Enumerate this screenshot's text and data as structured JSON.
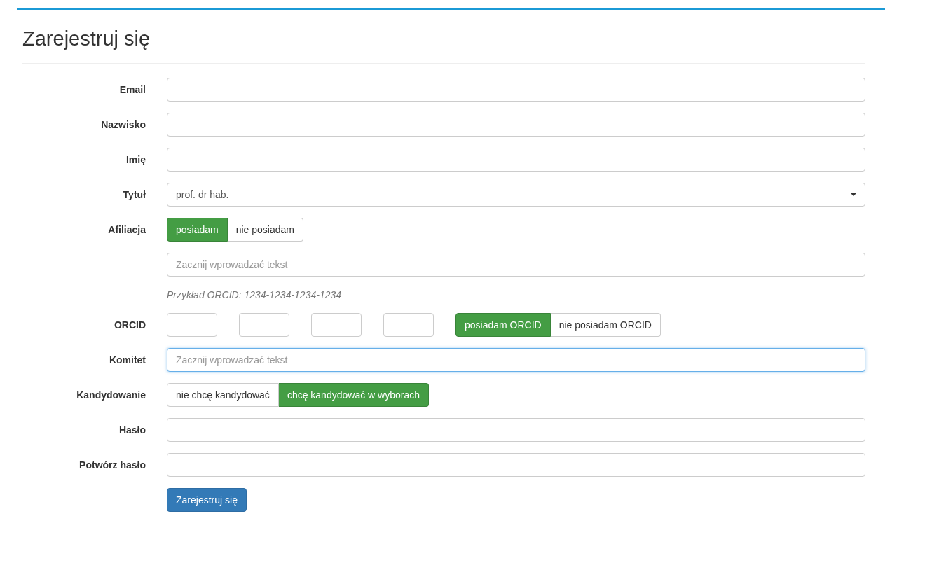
{
  "title": "Zarejestruj się",
  "rows": [
    {
      "kind": "text",
      "label": "Email",
      "focused": false
    },
    {
      "kind": "text",
      "label": "Nazwisko",
      "focused": false
    },
    {
      "kind": "text",
      "label": "Imię",
      "focused": false
    },
    {
      "kind": "select",
      "label": "Tytuł",
      "value": "prof. dr hab."
    },
    {
      "kind": "toggle",
      "label": "Afiliacja",
      "options": [
        {
          "label": "posiadam",
          "selected": true
        },
        {
          "label": "nie posiadam",
          "selected": false
        }
      ]
    },
    {
      "kind": "text",
      "placeholder": "Zacznij wprowadzać tekst",
      "focused": false
    },
    {
      "kind": "help",
      "text": "Przykład ORCID: 1234-1234-1234-1234"
    },
    {
      "kind": "orcid",
      "label": "ORCID",
      "options": [
        {
          "label": "posiadam ORCID",
          "selected": true
        },
        {
          "label": "nie posiadam ORCID",
          "selected": false
        }
      ]
    },
    {
      "kind": "text",
      "label": "Komitet",
      "placeholder": "Zacznij wprowadzać tekst",
      "focused": true
    },
    {
      "kind": "toggle",
      "label": "Kandydowanie",
      "options": [
        {
          "label": "nie chcę kandydować",
          "selected": false
        },
        {
          "label": "chcę kandydować w wyborach",
          "selected": true
        }
      ]
    },
    {
      "kind": "text",
      "label": "Hasło",
      "focused": false
    },
    {
      "kind": "text",
      "label": "Potwórz hasło",
      "focused": false
    }
  ],
  "submit": "Zarejestruj się"
}
